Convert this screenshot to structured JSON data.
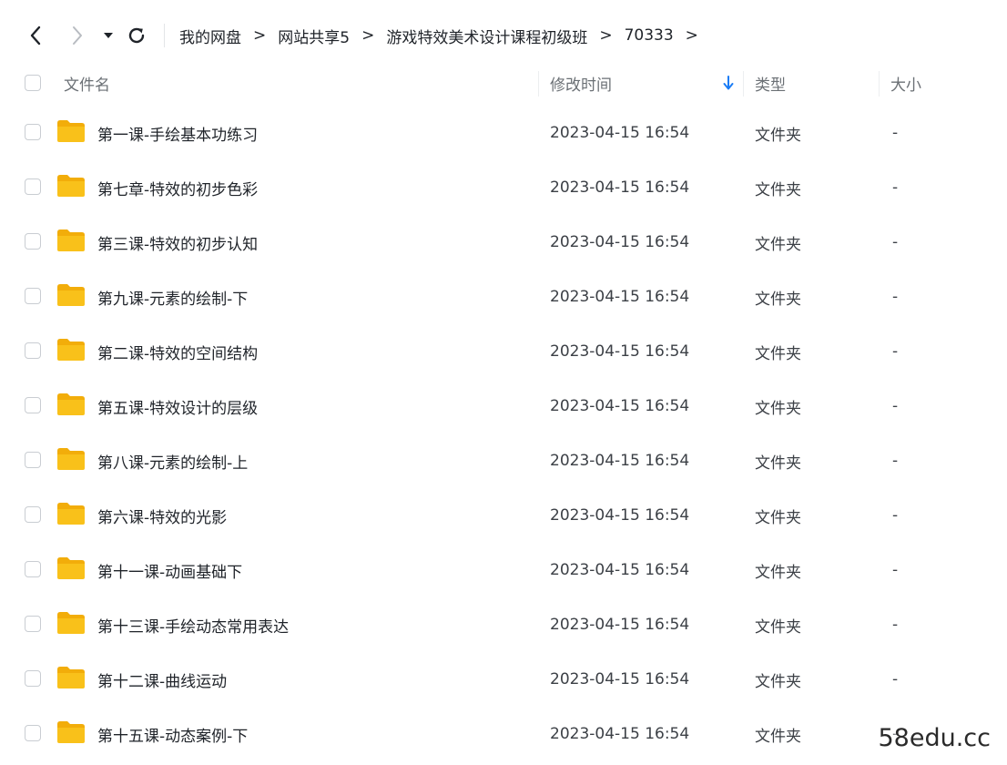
{
  "breadcrumb": [
    "我的网盘",
    "网站共享5",
    "游戏特效美术设计课程初级班",
    "70333"
  ],
  "breadcrumb_separator": ">",
  "nav": {
    "back_icon": "chevron-left-icon",
    "forward_icon": "chevron-right-icon",
    "history_icon": "caret-down-icon",
    "refresh_icon": "refresh-icon"
  },
  "columns": {
    "name": "文件名",
    "modified": "修改时间",
    "type": "类型",
    "size": "大小",
    "sort_icon": "arrow-down-icon"
  },
  "colors": {
    "accent": "#1a7cf5",
    "folder": "#f9c11a",
    "folder_dark": "#f2ad0a"
  },
  "files": [
    {
      "name": "第一课-手绘基本功练习",
      "modified": "2023-04-15 16:54",
      "type": "文件夹",
      "size": "-"
    },
    {
      "name": "第七章-特效的初步色彩",
      "modified": "2023-04-15 16:54",
      "type": "文件夹",
      "size": "-"
    },
    {
      "name": "第三课-特效的初步认知",
      "modified": "2023-04-15 16:54",
      "type": "文件夹",
      "size": "-"
    },
    {
      "name": "第九课-元素的绘制-下",
      "modified": "2023-04-15 16:54",
      "type": "文件夹",
      "size": "-"
    },
    {
      "name": "第二课-特效的空间结构",
      "modified": "2023-04-15 16:54",
      "type": "文件夹",
      "size": "-"
    },
    {
      "name": "第五课-特效设计的层级",
      "modified": "2023-04-15 16:54",
      "type": "文件夹",
      "size": "-"
    },
    {
      "name": "第八课-元素的绘制-上",
      "modified": "2023-04-15 16:54",
      "type": "文件夹",
      "size": "-"
    },
    {
      "name": "第六课-特效的光影",
      "modified": "2023-04-15 16:54",
      "type": "文件夹",
      "size": "-"
    },
    {
      "name": "第十一课-动画基础下",
      "modified": "2023-04-15 16:54",
      "type": "文件夹",
      "size": "-"
    },
    {
      "name": "第十三课-手绘动态常用表达",
      "modified": "2023-04-15 16:54",
      "type": "文件夹",
      "size": "-"
    },
    {
      "name": "第十二课-曲线运动",
      "modified": "2023-04-15 16:54",
      "type": "文件夹",
      "size": "-"
    },
    {
      "name": "第十五课-动态案例-下",
      "modified": "2023-04-15 16:54",
      "type": "文件夹",
      "size": "-"
    }
  ],
  "watermark": "58edu.cc"
}
